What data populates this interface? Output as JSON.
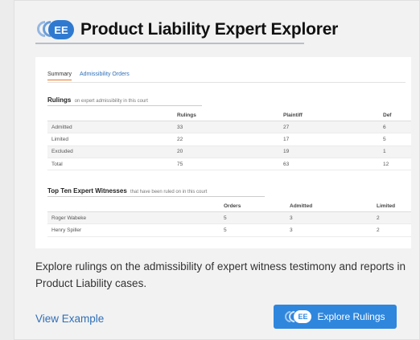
{
  "header": {
    "logo_badge": "EE",
    "title": "Product Liability Expert Explorer"
  },
  "preview": {
    "tabs": [
      "Summary",
      "Admissibility Orders"
    ],
    "rulings": {
      "title": "Rulings",
      "subtitle": "on expert admissibility in this court",
      "columns": [
        "",
        "Rulings",
        "Plaintiff",
        "Def"
      ],
      "rows": [
        [
          "Admitted",
          "33",
          "27",
          "6"
        ],
        [
          "Limited",
          "22",
          "17",
          "5"
        ],
        [
          "Excluded",
          "20",
          "19",
          "1"
        ],
        [
          "Total",
          "75",
          "63",
          "12"
        ]
      ]
    },
    "witnesses": {
      "title": "Top Ten Expert Witnesses",
      "subtitle": "that have been ruled on in this court",
      "columns": [
        "",
        "Orders",
        "Admitted",
        "Limited"
      ],
      "rows": [
        [
          "Roger Wabeke",
          "5",
          "3",
          "2"
        ],
        [
          "Henry Spiller",
          "5",
          "3",
          "2"
        ]
      ]
    }
  },
  "description": "Explore rulings on the admissibility of expert witness testimony and reports in Product Liability cases.",
  "actions": {
    "view_example": "View Example",
    "explore_badge": "EE",
    "explore": "Explore Rulings"
  },
  "colors": {
    "accent": "#2f86dd",
    "link": "#2f6fb7",
    "tab_underline": "#e87a2a"
  }
}
